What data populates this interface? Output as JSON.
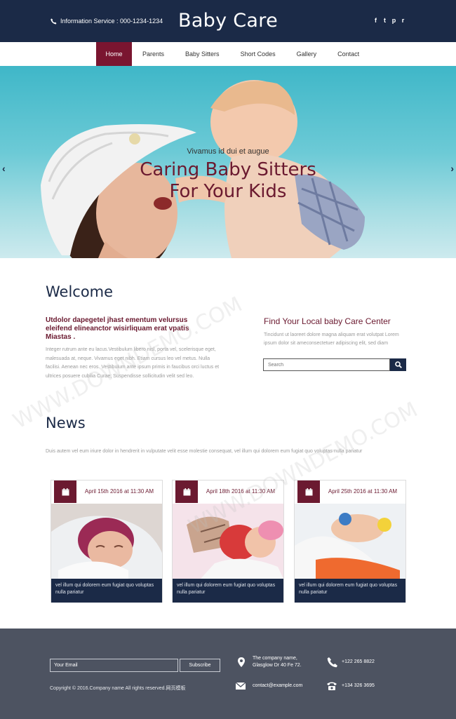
{
  "header": {
    "info_label": "Information Service : 000-1234-1234",
    "brand": "Baby Care",
    "social_icons": [
      "facebook-icon",
      "twitter-icon",
      "pinterest-icon",
      "rss-icon"
    ],
    "social_glyphs": [
      "f",
      "t",
      "p",
      "r"
    ]
  },
  "nav": {
    "items": [
      "Home",
      "Parents",
      "Baby Sitters",
      "Short Codes",
      "Gallery",
      "Contact"
    ],
    "active": "Home"
  },
  "hero": {
    "subtitle": "Vivamus id dui et augue",
    "title_line1": "Caring Baby Sitters",
    "title_line2": "For Your Kids",
    "prev_arrow": "‹",
    "next_arrow": "›"
  },
  "welcome": {
    "title": "Welcome",
    "lead": "Utdolor dapegetel jhast ementum velursus eleifend elineanctor wisirliquam erat vpatis Miastas .",
    "body": "Integer rutrum ante eu lacus.Vestibulum libero nisl, porta vel, scelerisque eget, malesuada at, neque. Vivamus eget nibh. Etiam cursus leo vel metus. Nulla facilisi. Aenean nec eros. Vestibulum ante ipsum primis in faucibus orci luctus et ultrices posuere cubilia Curae; Suspendisse sollicitudin velit sed leo."
  },
  "find": {
    "title": "Find Your Local baby Care Center",
    "body": "Tincidunt ut laoreet dolore magna aliquam erat volutpat Lorem ipsum dolor sit ameconsectetuer adipiscing elit, sed diam",
    "search_placeholder": "Search"
  },
  "news": {
    "title": "News",
    "intro": "Duis autem vel eum iriure dolor in hendrerit in vulputate velit esse molestie consequat, vel illum qui dolorem eum fugiat quo voluptas nulla pariatur",
    "cards": [
      {
        "date": "April 15th 2016 at 11:30 AM",
        "caption": "vel illum qui dolorem eum fugiat quo voluptas nulla pariatur"
      },
      {
        "date": "April 18th 2016 at 11:30 AM",
        "caption": "vel illum qui dolorem eum fugiat quo voluptas nulla pariatur"
      },
      {
        "date": "April 25th 2016 at 11:30 AM",
        "caption": "vel illum qui dolorem eum fugiat quo voluptas nulla pariatur"
      }
    ]
  },
  "footer": {
    "email_placeholder": "Your Email",
    "subscribe_label": "Subscribe",
    "copyright": "Copyright © 2016.Company name All rights reserved.网页模板",
    "address_line1": "The company name,",
    "address_line2": "Glasglow Dr 40 Fe 72.",
    "email": "contact@example.com",
    "phone1": "+122 265 8822",
    "phone2": "+134 326 3695"
  },
  "watermark": "WWW.DOWNDEMO.COM",
  "colors": {
    "navy": "#1b2a47",
    "maroon": "#6b1a30",
    "footer_bg": "#4d5361"
  }
}
